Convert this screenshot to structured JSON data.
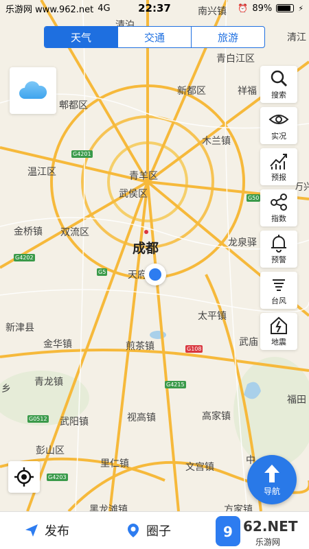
{
  "status_bar": {
    "carrier": "乐游网 www.962.net",
    "network": "4G",
    "time": "22:37",
    "battery": "89%"
  },
  "tabs": [
    {
      "label": "天气",
      "active": true
    },
    {
      "label": "交通",
      "active": false
    },
    {
      "label": "旅游",
      "active": false
    }
  ],
  "weather_card": {
    "icon": "cloud-icon"
  },
  "tools": [
    {
      "label": "搜索",
      "icon": "search-icon"
    },
    {
      "label": "实况",
      "icon": "eye-icon"
    },
    {
      "label": "预报",
      "icon": "trend-chart-icon"
    },
    {
      "label": "指数",
      "icon": "share-nodes-icon"
    },
    {
      "label": "预警",
      "icon": "bell-icon"
    },
    {
      "label": "台风",
      "icon": "typhoon-icon"
    },
    {
      "label": "地震",
      "icon": "earthquake-icon"
    }
  ],
  "map": {
    "labels": {
      "nanxing": "南兴镇",
      "qingdou": "清泊",
      "qingjiang": "清江",
      "qingbaijiang": "青白江区",
      "xindu": "新都区",
      "xiangfu": "祥福",
      "pidu": "郫都区",
      "mulan": "木兰镇",
      "wenjiang": "温江区",
      "qingyang": "青羊区",
      "wuhou": "武侯区",
      "wan": "万兴",
      "jinqiao": "金桥镇",
      "shuangliu": "双流区",
      "chengdu": "成都",
      "longquanyi": "龙泉驿",
      "tianfu": "天府新区",
      "taiping": "太平镇",
      "xinjin": "新津县",
      "huaqiao": "金华镇",
      "jiancha": "煎茶镇",
      "wumiao": "武庙",
      "xiang": "乡",
      "qinglong": "青龙镇",
      "fujia": "福田",
      "wuyang": "武阳镇",
      "shigao": "视高镇",
      "gaojia": "高家镇",
      "pengshan": "彭山区",
      "lirenzhen": "里仁镇",
      "wengong": "文宫镇",
      "heilong": "黑龙滩镇",
      "fangjia": "方家镇",
      "zhong": "中"
    },
    "roads": {
      "g4201": "G4201",
      "g5": "G5",
      "g4202": "G4202",
      "g50": "G50",
      "g108": "G108",
      "g4215": "G4215",
      "g0512": "G0512",
      "g4203": "G4203"
    }
  },
  "nav_button": {
    "label": "导航"
  },
  "bottom_bar": {
    "publish": "发布",
    "circle": "圈子"
  },
  "watermark": {
    "text": "962.NET",
    "sub": "乐游网"
  }
}
